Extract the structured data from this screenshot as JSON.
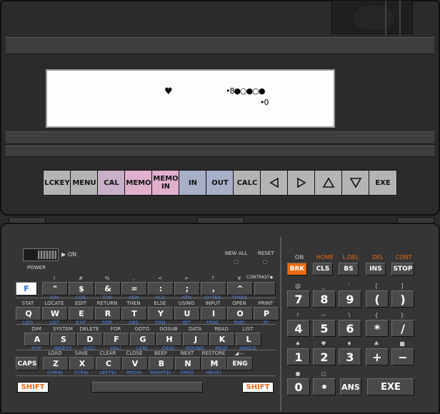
{
  "display": {
    "row1_heart": "♥",
    "row1_glyphs": "•8●○●○●",
    "row2_glyphs": "•0"
  },
  "colors": {
    "fk_gray": "#b4b4b4",
    "fk_purple": "#c8a8c8",
    "fk_pink": "#e0b0cc",
    "fk_blue": "#a8b0c8",
    "orange": "#e86a10",
    "brk_bg": "#e86a10",
    "f_key_bg": "#ffffff",
    "f_key_text": "#2a6fd6",
    "shift_text": "#e86a10",
    "blue_label": "#4d7fe0"
  },
  "function_keys": [
    {
      "label": "LCKEY",
      "color": "#b4b4b4"
    },
    {
      "label": "MENU",
      "color": "#b4b4b4"
    },
    {
      "label": "CAL",
      "color": "#c8b0c8"
    },
    {
      "label": "MEMO",
      "color": "#e0b0cc"
    },
    {
      "label": "MEMO IN",
      "color": "#e0b0cc"
    },
    {
      "label": "IN",
      "color": "#a8b0c8"
    },
    {
      "label": "OUT",
      "color": "#a8b0c8"
    },
    {
      "label": "CALC",
      "color": "#b4b4b4"
    },
    {
      "label": "◁",
      "color": "#b4b4b4",
      "icon": "left-arrow"
    },
    {
      "label": "▷",
      "color": "#b4b4b4",
      "icon": "right-arrow"
    },
    {
      "label": "△",
      "color": "#b4b4b4",
      "icon": "up-arrow"
    },
    {
      "label": "▽",
      "color": "#b4b4b4",
      "icon": "down-arrow"
    },
    {
      "label": "EXE",
      "color": "#b4b4b4"
    }
  ],
  "labels": {
    "on_arrow": "▶ ON",
    "power": "POWER",
    "new_all": "NEW ALL",
    "reset": "RESET",
    "contrast": "CONTRAST◆"
  },
  "row1": [
    {
      "key": "F",
      "top": "",
      "bot": ""
    },
    {
      "key": "\"",
      "top": "!",
      "bot": "SIN"
    },
    {
      "key": "$",
      "top": "#",
      "bot": "COS"
    },
    {
      "key": "&",
      "top": "%",
      "bot": "TAN"
    },
    {
      "key": "=",
      "top": ",",
      "bot": "ASN"
    },
    {
      "key": ":",
      "top": "<",
      "bot": "ACS"
    },
    {
      "key": ";",
      "top": ">",
      "bot": "ATN"
    },
    {
      "key": ",",
      "top": "?",
      "bot": "DATE$"
    },
    {
      "key": "^",
      "top": "¥",
      "bot": "TIME$"
    }
  ],
  "row2": [
    {
      "key": "Q",
      "top": "STAT",
      "bot": "LOG"
    },
    {
      "key": "W",
      "top": "LOCATE",
      "bot": "LGT"
    },
    {
      "key": "E",
      "top": "EDIT",
      "bot": "EXP"
    },
    {
      "key": "R",
      "top": "RETURN",
      "bot": "SQR"
    },
    {
      "key": "T",
      "top": "THEN",
      "bot": "ABS"
    },
    {
      "key": "Y",
      "top": "ELSE",
      "bot": "SGN"
    },
    {
      "key": "U",
      "top": "USING",
      "bot": "INT"
    },
    {
      "key": "I",
      "top": "INPUT",
      "bot": "FRAC"
    },
    {
      "key": "O",
      "top": "OPEN",
      "bot": "RND"
    },
    {
      "key": "P",
      "top": "PRINT",
      "bot": "PI"
    }
  ],
  "row3": [
    {
      "key": "A",
      "top": "DIM",
      "bot": "HYP"
    },
    {
      "key": "S",
      "top": "SYSTEM",
      "bot": "INKEY$"
    },
    {
      "key": "D",
      "top": "DELETE",
      "bot": "ASCI"
    },
    {
      "key": "F",
      "top": "FOR",
      "bot": "VAL("
    },
    {
      "key": "G",
      "top": "GOTO",
      "bot": "LEN("
    },
    {
      "key": "H",
      "top": "GOSUB",
      "bot": "DEG("
    },
    {
      "key": "J",
      "top": "DATA",
      "bot": "ROUND"
    },
    {
      "key": "K",
      "top": "READ",
      "bot": "MOD"
    },
    {
      "key": "L",
      "top": "LIST",
      "bot": "ANGLE"
    }
  ],
  "row4": [
    {
      "key": "CAPS",
      "top": "",
      "bot": ""
    },
    {
      "key": "Z",
      "top": "LOAD",
      "bot": "CHR$("
    },
    {
      "key": "X",
      "top": "SAVE",
      "bot": "STR$("
    },
    {
      "key": "C",
      "top": "CLEAR",
      "bot": "LEFT$("
    },
    {
      "key": "V",
      "top": "CLOSE",
      "bot": "MID$("
    },
    {
      "key": "B",
      "top": "BEEP",
      "bot": "RIGHT$("
    },
    {
      "key": "N",
      "top": "NEXT",
      "bot": "DMS("
    },
    {
      "key": "M",
      "top": "RESTORE",
      "bot": "HEX$("
    },
    {
      "key": "ENG",
      "top": "◢—",
      "bot": ""
    }
  ],
  "shift_label": "SHIFT",
  "right_top": [
    {
      "key": "BRK",
      "label": "ON",
      "label_color": "#d0d0d0"
    },
    {
      "key": "CLS",
      "label": "HOME",
      "label_color": "#e86a10"
    },
    {
      "key": "BS",
      "label": "L.DEL",
      "label_color": "#e86a10"
    },
    {
      "key": "INS",
      "label": "DEL",
      "label_color": "#e86a10"
    },
    {
      "key": "STOP",
      "label": "CONT",
      "label_color": "#e86a10"
    }
  ],
  "numpad": [
    [
      {
        "key": "7",
        "top": "@"
      },
      {
        "key": "8",
        "top": "_"
      },
      {
        "key": "9",
        "top": "`"
      },
      {
        "key": "(",
        "top": "["
      },
      {
        "key": ")",
        "top": "]"
      }
    ],
    [
      {
        "key": "4",
        "top": "!"
      },
      {
        "key": "5",
        "top": "~"
      },
      {
        "key": "6",
        "top": "\\"
      },
      {
        "key": "*",
        "top": "{"
      },
      {
        "key": "/",
        "top": "}"
      }
    ],
    [
      {
        "key": "1",
        "top": "♠"
      },
      {
        "key": "2",
        "top": "♥"
      },
      {
        "key": "3",
        "top": "♦"
      },
      {
        "key": "+",
        "top": "♣"
      },
      {
        "key": "−",
        "top": "■"
      }
    ],
    [
      {
        "key": "0",
        "top": "●"
      },
      {
        "key": "•",
        "top": "○"
      },
      {
        "key": "ANS",
        "top": ""
      },
      {
        "key": "EXE",
        "top": ""
      }
    ]
  ]
}
